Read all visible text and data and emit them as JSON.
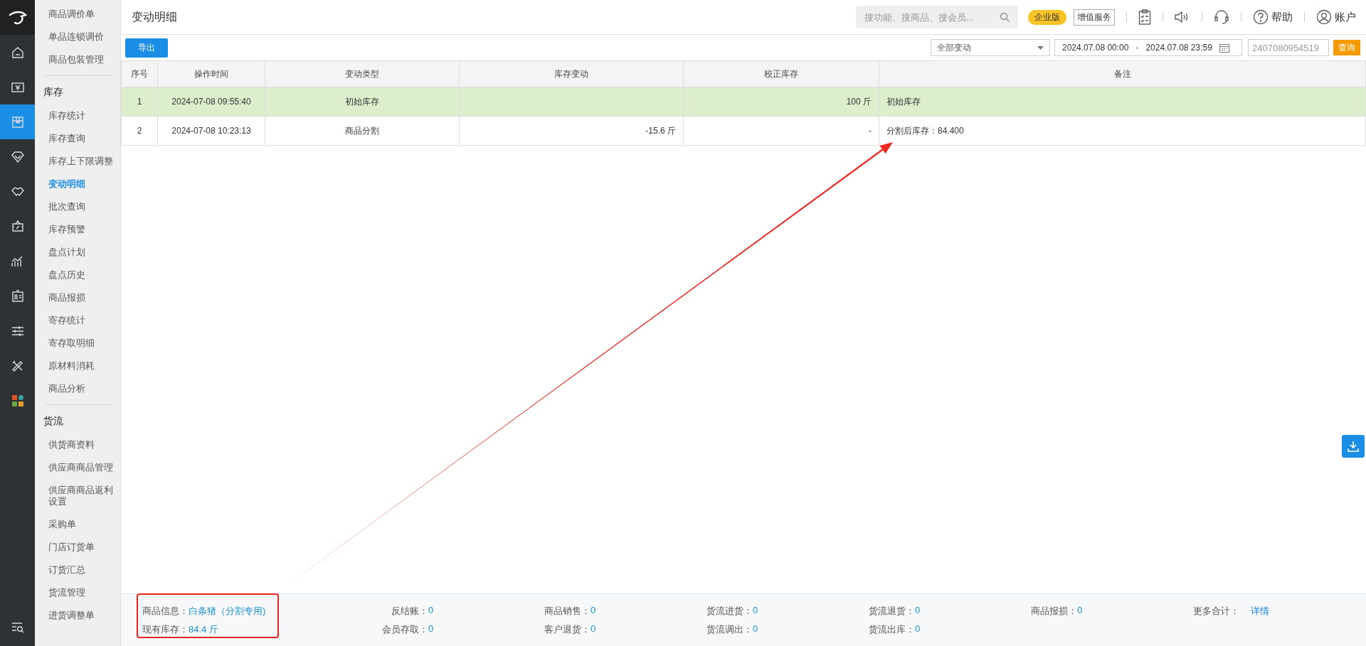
{
  "rail": [
    {
      "kind": "home",
      "selected": false
    },
    {
      "kind": "money",
      "selected": false
    },
    {
      "kind": "box",
      "selected": true
    },
    {
      "kind": "diamond",
      "selected": false
    },
    {
      "kind": "handshake",
      "selected": false
    },
    {
      "kind": "ticket",
      "selected": false
    },
    {
      "kind": "chart",
      "selected": false
    },
    {
      "kind": "card",
      "selected": false
    },
    {
      "kind": "sliders",
      "selected": false
    },
    {
      "kind": "tools",
      "selected": false
    },
    {
      "kind": "apps",
      "selected": false
    }
  ],
  "sidebar": {
    "groups": [
      {
        "items": [
          {
            "label": "商品调价单",
            "selected": false
          },
          {
            "label": "单品连锁调价",
            "selected": false
          },
          {
            "label": "商品包装管理",
            "selected": false
          }
        ]
      },
      {
        "title": "库存",
        "items": [
          {
            "label": "库存统计",
            "selected": false
          },
          {
            "label": "库存查询",
            "selected": false
          },
          {
            "label": "库存上下限调整",
            "selected": false
          },
          {
            "label": "变动明细",
            "selected": true
          },
          {
            "label": "批次查询",
            "selected": false
          },
          {
            "label": "库存预警",
            "selected": false
          },
          {
            "label": "盘点计划",
            "selected": false
          },
          {
            "label": "盘点历史",
            "selected": false
          },
          {
            "label": "商品报损",
            "selected": false
          },
          {
            "label": "寄存统计",
            "selected": false
          },
          {
            "label": "寄存取明细",
            "selected": false
          },
          {
            "label": "原材料消耗",
            "selected": false
          },
          {
            "label": "商品分析",
            "selected": false
          }
        ]
      },
      {
        "title": "货流",
        "items": [
          {
            "label": "供货商资料",
            "selected": false
          },
          {
            "label": "供应商商品管理",
            "selected": false
          },
          {
            "label": "供应商商品返利设置",
            "selected": false
          },
          {
            "label": "采购单",
            "selected": false
          },
          {
            "label": "门店订货单",
            "selected": false
          },
          {
            "label": "订货汇总",
            "selected": false
          },
          {
            "label": "货流管理",
            "selected": false
          },
          {
            "label": "进货调整单",
            "selected": false
          }
        ]
      }
    ]
  },
  "header": {
    "title": "变动明细",
    "search": {
      "placeholder": "搜功能、搜商品、搜会员..."
    },
    "edition": "企业版",
    "value_added": "增值服务",
    "help": "帮助",
    "account": "账户"
  },
  "toolbar": {
    "export": "导出",
    "filter": "全部变动",
    "date_from": "2024.07.08 00:00",
    "date_separator": "-",
    "date_to": "2024.07.08 23:59",
    "code": {
      "placeholder": "2407080954519"
    },
    "query": "查询"
  },
  "table": {
    "columns": [
      "序号",
      "操作时间",
      "变动类型",
      "库存变动",
      "校正库存",
      "备注"
    ],
    "rows": [
      {
        "selected": true,
        "cells": [
          "1",
          "2024-07-08 09:55:40",
          "初始库存",
          "",
          "100 斤",
          "初始库存"
        ]
      },
      {
        "selected": false,
        "cells": [
          "2",
          "2024-07-08 10:23:13",
          "商品分割",
          "-15.6 斤",
          "-",
          "分割后库存：84.400"
        ]
      }
    ]
  },
  "summary": {
    "product": {
      "label": "商品信息：",
      "value": "白条猪（分割专用)"
    },
    "stock": {
      "label": "现有库存：",
      "value": "84.4 斤"
    },
    "stats": [
      {
        "label": "反结账：",
        "value": "0"
      },
      {
        "label": "商品销售：",
        "value": "0"
      },
      {
        "label": "货流进货：",
        "value": "0"
      },
      {
        "label": "货流退货：",
        "value": "0"
      },
      {
        "label": "商品报损：",
        "value": "0"
      },
      {
        "label": "会员存取：",
        "value": "0"
      },
      {
        "label": "客户退货：",
        "value": "0"
      },
      {
        "label": "货流调出：",
        "value": "0"
      },
      {
        "label": "货流出库：",
        "value": "0"
      }
    ],
    "more": {
      "label": "更多合计：",
      "link": "详情"
    }
  }
}
